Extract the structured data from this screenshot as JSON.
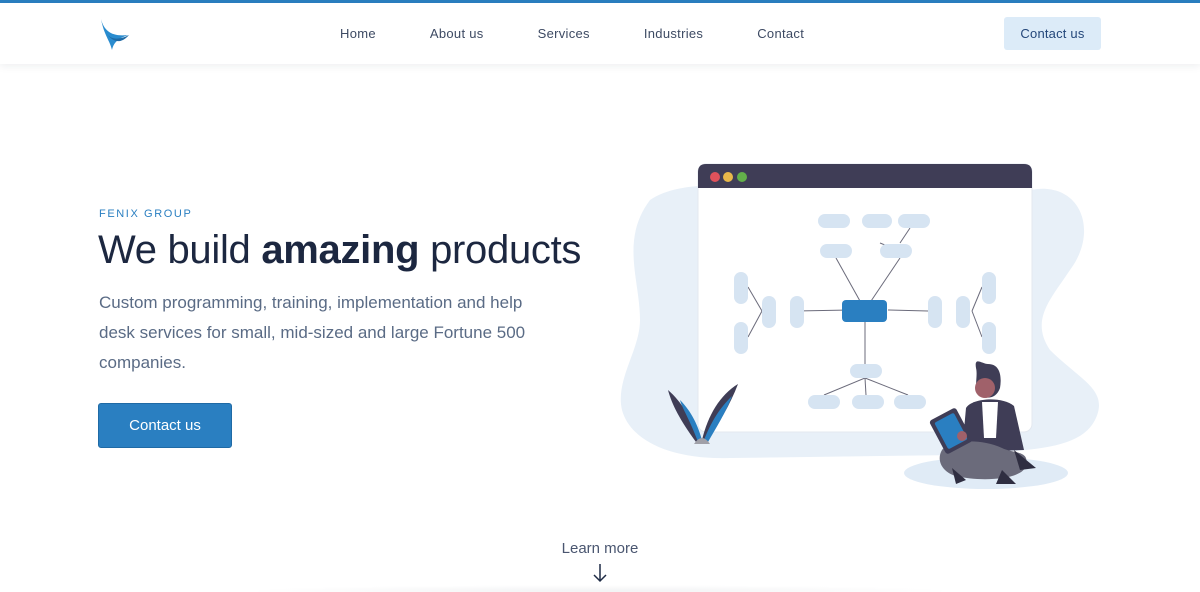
{
  "brand": {
    "logo_icon": "bird-icon",
    "accent_color": "#2a7fc1"
  },
  "nav": {
    "links": [
      "Home",
      "About us",
      "Services",
      "Industries",
      "Contact"
    ],
    "cta_label": "Contact us"
  },
  "hero": {
    "eyebrow": "FENIX GROUP",
    "headline_prefix": "We build ",
    "headline_emphasis": "amazing",
    "headline_suffix": " products",
    "subtext": "Custom programming, training, implementation and help desk services for small, mid-sized and large Fortune 500 companies.",
    "cta_label": "Contact us",
    "illustration_icon": "mind-map-illustration"
  },
  "footer_hint": {
    "label": "Learn more",
    "icon": "arrow-down-icon"
  }
}
